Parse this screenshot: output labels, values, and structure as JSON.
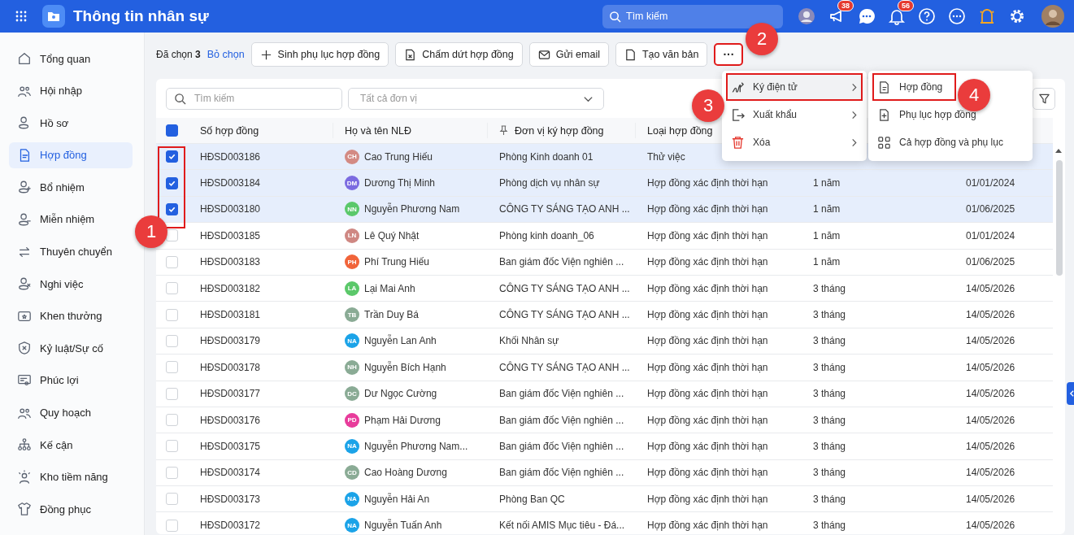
{
  "topbar": {
    "title": "Thông tin nhân sự",
    "search_placeholder": "Tìm kiếm",
    "badges": [
      "38",
      "56"
    ]
  },
  "sidebar": {
    "items": [
      {
        "label": "Tổng quan",
        "selected": false
      },
      {
        "label": "Hội nhập",
        "selected": false
      },
      {
        "label": "Hồ sơ",
        "selected": false
      },
      {
        "label": "Hợp đồng",
        "selected": true
      },
      {
        "label": "Bổ nhiệm",
        "selected": false
      },
      {
        "label": "Miễn nhiệm",
        "selected": false
      },
      {
        "label": "Thuyên chuyển",
        "selected": false
      },
      {
        "label": "Nghi việc",
        "selected": false
      },
      {
        "label": "Khen thưởng",
        "selected": false
      },
      {
        "label": "Kỷ luật/Sự cố",
        "selected": false
      },
      {
        "label": "Phúc lợi",
        "selected": false
      },
      {
        "label": "Quy hoạch",
        "selected": false
      },
      {
        "label": "Kế cận",
        "selected": false
      },
      {
        "label": "Kho tiềm năng",
        "selected": false
      },
      {
        "label": "Đồng phục",
        "selected": false
      }
    ]
  },
  "toolbar": {
    "selection": "Đã chọn **3**",
    "clear": "Bỏ chọn",
    "buttons": [
      {
        "label": "Sinh phụ lục hợp đồng",
        "kind": "plus"
      },
      {
        "label": "Chấm dứt hợp đồng",
        "kind": "close-doc"
      },
      {
        "label": "Gửi email",
        "kind": "mail"
      },
      {
        "label": "Tạo văn bản",
        "kind": "doc"
      }
    ],
    "more": {
      "label": "···",
      "highlighted": true
    }
  },
  "filters": {
    "search_placeholder": "Tìm kiếm",
    "unit_placeholder": "Tất cả đơn vị"
  },
  "menu": {
    "items": [
      {
        "label": "Ký điện tử",
        "kind": "sign",
        "highlighted": true
      },
      {
        "label": "Xuất khẩu",
        "kind": "export",
        "highlighted": false
      },
      {
        "label": "Xóa",
        "kind": "delete",
        "highlighted": false
      }
    ]
  },
  "submenu": {
    "items": [
      {
        "label": "Hợp đồng",
        "kind": "doc",
        "highlighted": true
      },
      {
        "label": "Phụ lục hợp đồng",
        "kind": "add-doc",
        "highlighted": false
      },
      {
        "label": "Cả hợp đồng và phụ lục",
        "kind": "grid",
        "highlighted": false
      }
    ]
  },
  "table": {
    "select_all": {
      "indeterminate": true
    },
    "checkbox_column_highlighted": true,
    "columns": [
      "Số hợp đồng",
      "Họ và tên NLĐ",
      "Đơn vị ký hợp đồng",
      "Loại hợp đồng"
    ],
    "rows": [
      {
        "selected": true,
        "code": "HĐSD003186",
        "initials": "CH",
        "color": "#d38a83",
        "name": "Cao Trung Hiếu",
        "unit": "Phòng Kinh doanh 01",
        "type": "Thử việc"
      },
      {
        "selected": true,
        "code": "HĐSD003184",
        "initials": "DM",
        "color": "#7b6be0",
        "name": "Dương Thị Minh",
        "unit": "Phòng dịch vụ nhân sự",
        "type": "Hợp đồng xác định thời hạn",
        "duration": "1 năm",
        "date": "01/01/2024"
      },
      {
        "selected": true,
        "code": "HĐSD003180",
        "initials": "NN",
        "color": "#5bc86a",
        "name": "Nguyễn Phương Nam",
        "unit": "CÔNG TY SÁNG TẠO ANH ...",
        "type": "Hợp đồng xác định thời hạn",
        "duration": "1 năm",
        "date": "01/06/2025"
      },
      {
        "selected": false,
        "code": "HĐSD003185",
        "initials": "LN",
        "color": "#cf8883",
        "name": "Lê Quý Nhật",
        "unit": "Phòng kinh doanh_06",
        "type": "Hợp đồng xác định thời hạn",
        "duration": "1 năm",
        "date": "01/01/2024"
      },
      {
        "selected": false,
        "code": "HĐSD003183",
        "initials": "PH",
        "color": "#f1643a",
        "name": "Phí Trung Hiếu",
        "unit": "Ban giám đốc Viện nghiên ...",
        "type": "Hợp đồng xác định thời hạn",
        "duration": "1 năm",
        "date": "01/06/2025"
      },
      {
        "selected": false,
        "code": "HĐSD003182",
        "initials": "LA",
        "color": "#5bc86a",
        "name": "Lại Mai Anh",
        "unit": "CÔNG TY SÁNG TẠO ANH ...",
        "type": "Hợp đồng xác định thời hạn",
        "duration": "3 tháng",
        "date": "14/05/2026"
      },
      {
        "selected": false,
        "code": "HĐSD003181",
        "initials": "TB",
        "color": "#8aab95",
        "name": "Trần Duy Bá",
        "unit": "CÔNG TY SÁNG TẠO ANH ...",
        "type": "Hợp đồng xác định thời hạn",
        "duration": "3 tháng",
        "date": "14/05/2026"
      },
      {
        "selected": false,
        "code": "HĐSD003179",
        "initials": "NA",
        "color": "#1ba3e8",
        "name": "Nguyễn Lan Anh",
        "unit": "Khối Nhân sự",
        "type": "Hợp đồng xác định thời hạn",
        "duration": "3 tháng",
        "date": "14/05/2026"
      },
      {
        "selected": false,
        "code": "HĐSD003178",
        "initials": "NH",
        "color": "#8aab95",
        "name": "Nguyễn Bích Hạnh",
        "unit": "CÔNG TY SÁNG TẠO ANH ...",
        "type": "Hợp đồng xác định thời hạn",
        "duration": "3 tháng",
        "date": "14/05/2026"
      },
      {
        "selected": false,
        "code": "HĐSD003177",
        "initials": "DC",
        "color": "#8aab95",
        "name": "Dư Ngọc Cường",
        "unit": "Ban giám đốc Viện nghiên ...",
        "type": "Hợp đồng xác định thời hạn",
        "duration": "3 tháng",
        "date": "14/05/2026"
      },
      {
        "selected": false,
        "code": "HĐSD003176",
        "initials": "PD",
        "color": "#e83c9b",
        "name": "Phạm Hải Dương",
        "unit": "Ban giám đốc Viện nghiên ...",
        "type": "Hợp đồng xác định thời hạn",
        "duration": "3 tháng",
        "date": "14/05/2026"
      },
      {
        "selected": false,
        "code": "HĐSD003175",
        "initials": "NA",
        "color": "#1ba3e8",
        "name": "Nguyễn Phương Nam...",
        "unit": "Ban giám đốc Viện nghiên ...",
        "type": "Hợp đồng xác định thời hạn",
        "duration": "3 tháng",
        "date": "14/05/2026"
      },
      {
        "selected": false,
        "code": "HĐSD003174",
        "initials": "CD",
        "color": "#8aab95",
        "name": "Cao Hoàng Dương",
        "unit": "Ban giám đốc Viện nghiên ...",
        "type": "Hợp đồng xác định thời hạn",
        "duration": "3 tháng",
        "date": "14/05/2026"
      },
      {
        "selected": false,
        "code": "HĐSD003173",
        "initials": "NA",
        "color": "#1ba3e8",
        "name": "Nguyễn Hải An",
        "unit": "Phòng Ban QC",
        "type": "Hợp đồng xác định thời hạn",
        "duration": "3 tháng",
        "date": "14/05/2026"
      },
      {
        "selected": false,
        "code": "HĐSD003172",
        "initials": "NA",
        "color": "#1ba3e8",
        "name": "Nguyễn Tuấn Anh",
        "unit": "Kết nối AMIS Mục tiêu - Đá...",
        "type": "Hợp đồng xác định thời hạn",
        "duration": "3 tháng",
        "date": "14/05/2026"
      }
    ]
  },
  "callouts": [
    "1",
    "2",
    "3",
    "4"
  ]
}
